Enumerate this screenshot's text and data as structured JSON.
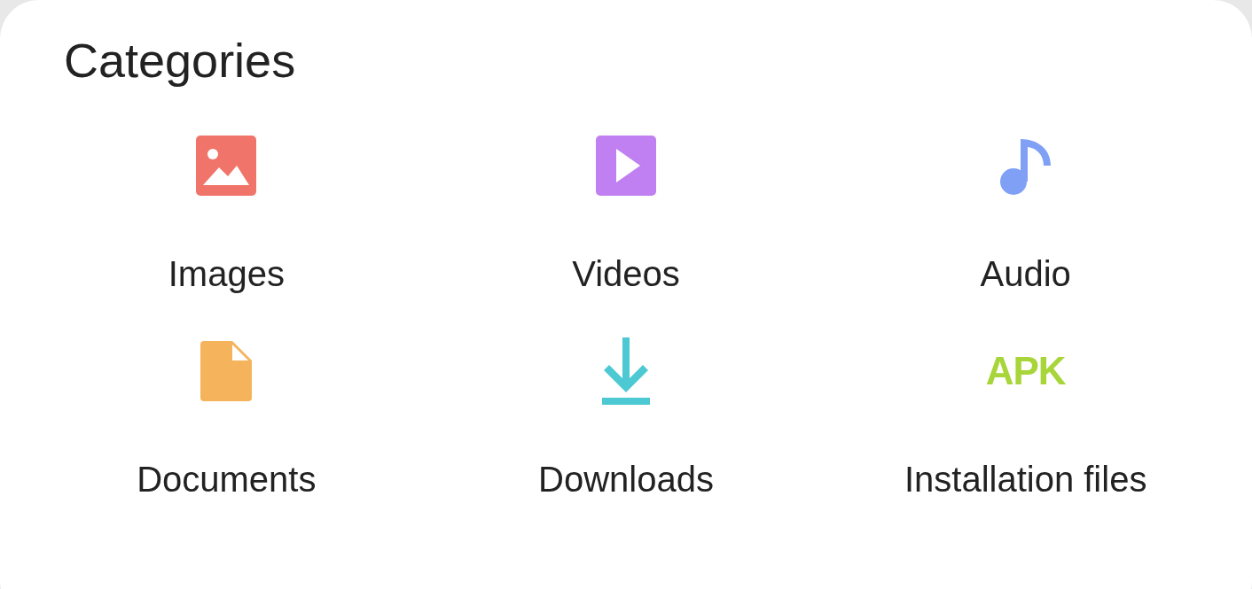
{
  "title": "Categories",
  "categories": [
    {
      "label": "Images",
      "kind": "image",
      "color": "#f07469"
    },
    {
      "label": "Videos",
      "kind": "video",
      "color": "#c180f2"
    },
    {
      "label": "Audio",
      "kind": "audio",
      "color": "#7fa0f5"
    },
    {
      "label": "Documents",
      "kind": "document",
      "color": "#f5b45c"
    },
    {
      "label": "Downloads",
      "kind": "download",
      "color": "#4dc9d3"
    },
    {
      "label": "Installation files",
      "kind": "apk",
      "color": "#a8d63a",
      "icon_text": "APK"
    }
  ]
}
